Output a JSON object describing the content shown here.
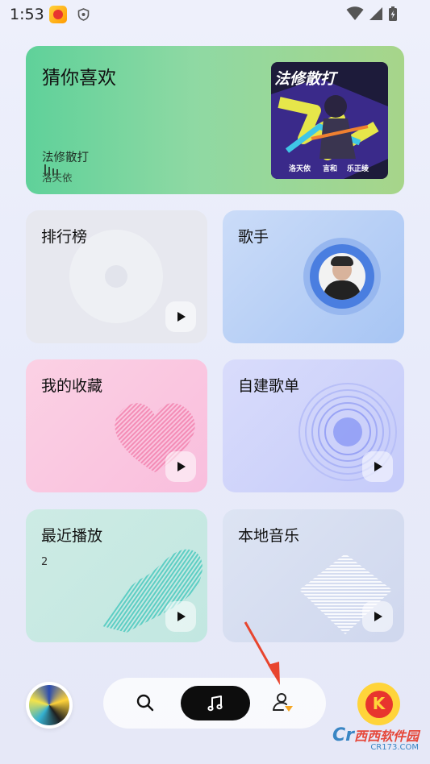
{
  "status_bar": {
    "time": "1:53"
  },
  "featured": {
    "title": "猜你喜欢",
    "song": "法修散打",
    "artist": "洛天依",
    "cover_title": "法修散打",
    "cover_artists": [
      "洛天依",
      "言和",
      "乐正绫"
    ]
  },
  "cards": {
    "rank": {
      "title": "排行榜"
    },
    "singer": {
      "title": "歌手"
    },
    "favorites": {
      "title": "我的收藏"
    },
    "playlist": {
      "title": "自建歌单"
    },
    "recent": {
      "title": "最近播放",
      "count": "2"
    },
    "local": {
      "title": "本地音乐"
    }
  },
  "watermark": "西西软件园",
  "watermark_sub": "CR173.COM",
  "colors": {
    "accent": "#0d0d0d",
    "kugou_yellow": "#ffd43a",
    "kugou_red": "#e8342e"
  }
}
